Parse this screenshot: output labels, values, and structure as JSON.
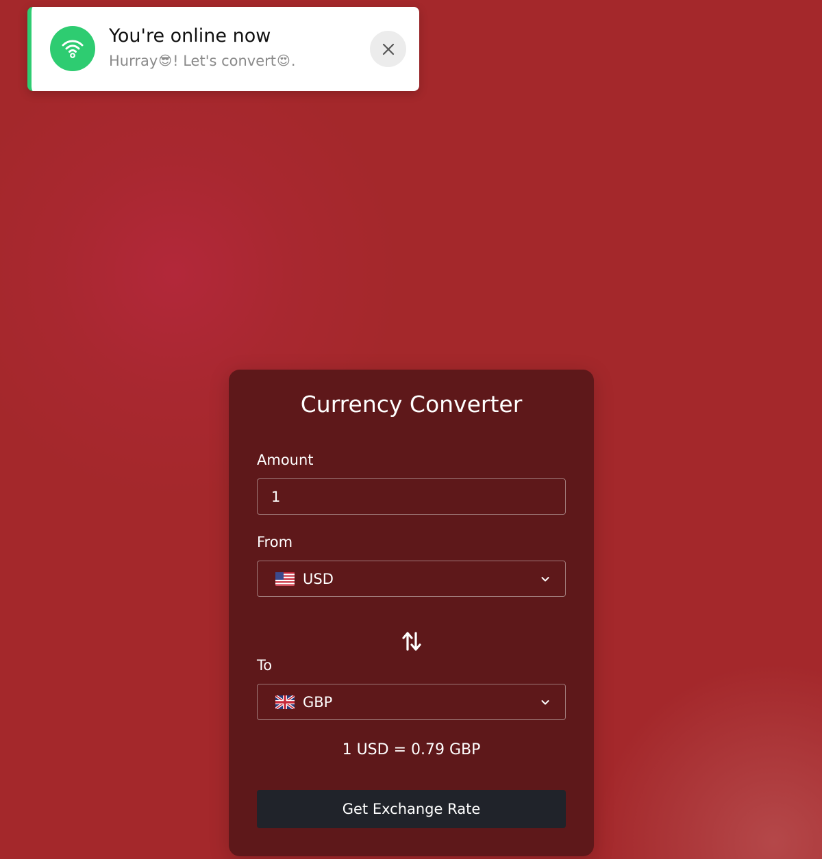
{
  "toast": {
    "title": "You're online now",
    "message_before": "Hurray",
    "message_emoji1": "😎",
    "message_middle": "! Let's convert",
    "message_emoji2": "😍",
    "message_after": ".",
    "accent_color": "#2ecc71",
    "icon": "wifi-icon",
    "close_icon": "close-icon"
  },
  "converter": {
    "title": "Currency Converter",
    "amount_label": "Amount",
    "amount_value": "1",
    "from_label": "From",
    "from_currency": "USD",
    "from_flag": "us-flag-icon",
    "to_label": "To",
    "to_currency": "GBP",
    "to_flag": "uk-flag-icon",
    "swap_icon": "swap-arrows-icon",
    "rate_text": "1 USD = 0.79 GBP",
    "button_label": "Get Exchange Rate"
  },
  "colors": {
    "background": "#a4282b",
    "card": "#5e181a",
    "button": "#20232a",
    "toast_accent": "#2ecc71"
  }
}
